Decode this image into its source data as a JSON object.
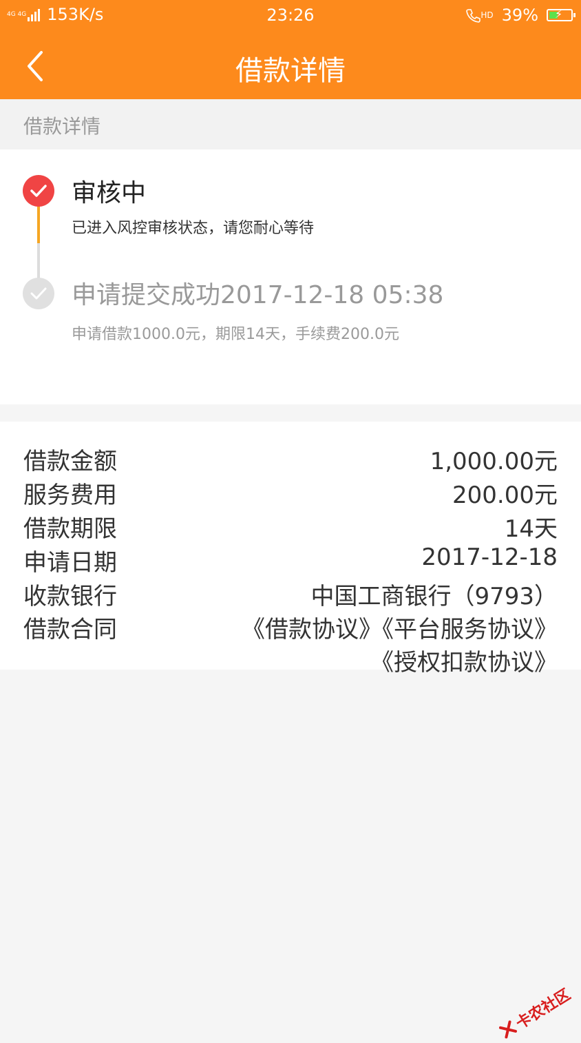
{
  "status_bar": {
    "network": "4G 4G",
    "speed": "153K/s",
    "time": "23:26",
    "call_icon_label": "HD",
    "battery": "39%"
  },
  "nav": {
    "title": "借款详情",
    "back_icon": "chevron-left-icon"
  },
  "section_header": "借款详情",
  "timeline": [
    {
      "title": "审核中",
      "desc": "已进入风控审核状态，请您耐心等待",
      "state": "active"
    },
    {
      "title": "申请提交成功2017-12-18 05:38",
      "desc": "申请借款1000.0元，期限14天，手续费200.0元",
      "state": "done"
    }
  ],
  "details": {
    "amount": {
      "label": "借款金额",
      "value": "1,000.00元"
    },
    "fee": {
      "label": "服务费用",
      "value": "200.00元"
    },
    "term": {
      "label": "借款期限",
      "value": "14天"
    },
    "date": {
      "label": "申请日期",
      "value": "2017-12-18"
    },
    "bank": {
      "label": "收款银行",
      "value": "中国工商银行（9793）"
    },
    "contract": {
      "label": "借款合同",
      "links": [
        "《借款协议》",
        "《平台服务协议》",
        "《授权扣款协议》"
      ]
    }
  },
  "watermark": "卡农社区",
  "colors": {
    "brand": "#fd8a1c",
    "accent_red": "#f04444",
    "timeline_orange": "#f5a623"
  }
}
